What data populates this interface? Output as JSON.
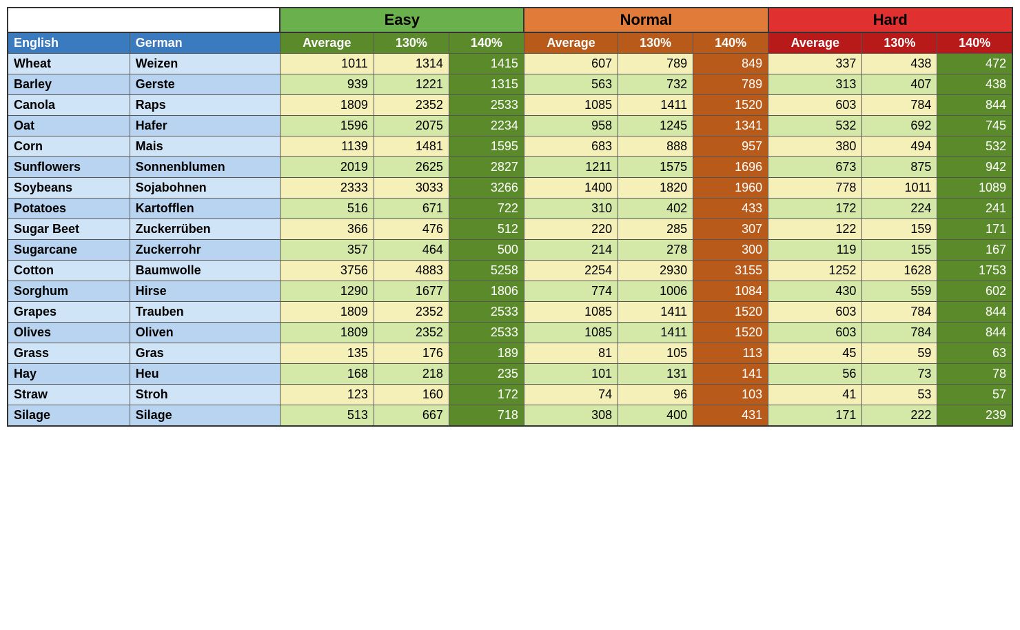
{
  "table": {
    "categories": [
      {
        "label": "Easy",
        "class": "cat-easy",
        "colspan": 3
      },
      {
        "label": "Normal",
        "class": "cat-normal",
        "colspan": 3
      },
      {
        "label": "Hard",
        "class": "cat-hard",
        "colspan": 3
      }
    ],
    "col_headers": {
      "english": "English",
      "german": "German",
      "sub_cols": [
        "Average",
        "130%",
        "140%",
        "Average",
        "130%",
        "140%",
        "Average",
        "130%",
        "140%"
      ]
    },
    "rows": [
      {
        "english": "Wheat",
        "german": "Weizen",
        "easy_avg": 1011,
        "easy_130": 1314,
        "easy_140": 1415,
        "norm_avg": 607,
        "norm_130": 789,
        "norm_140": 849,
        "hard_avg": 337,
        "hard_130": 438,
        "hard_140": 472
      },
      {
        "english": "Barley",
        "german": "Gerste",
        "easy_avg": 939,
        "easy_130": 1221,
        "easy_140": 1315,
        "norm_avg": 563,
        "norm_130": 732,
        "norm_140": 789,
        "hard_avg": 313,
        "hard_130": 407,
        "hard_140": 438
      },
      {
        "english": "Canola",
        "german": "Raps",
        "easy_avg": 1809,
        "easy_130": 2352,
        "easy_140": 2533,
        "norm_avg": 1085,
        "norm_130": 1411,
        "norm_140": 1520,
        "hard_avg": 603,
        "hard_130": 784,
        "hard_140": 844
      },
      {
        "english": "Oat",
        "german": "Hafer",
        "easy_avg": 1596,
        "easy_130": 2075,
        "easy_140": 2234,
        "norm_avg": 958,
        "norm_130": 1245,
        "norm_140": 1341,
        "hard_avg": 532,
        "hard_130": 692,
        "hard_140": 745
      },
      {
        "english": "Corn",
        "german": "Mais",
        "easy_avg": 1139,
        "easy_130": 1481,
        "easy_140": 1595,
        "norm_avg": 683,
        "norm_130": 888,
        "norm_140": 957,
        "hard_avg": 380,
        "hard_130": 494,
        "hard_140": 532
      },
      {
        "english": "Sunflowers",
        "german": "Sonnenblumen",
        "easy_avg": 2019,
        "easy_130": 2625,
        "easy_140": 2827,
        "norm_avg": 1211,
        "norm_130": 1575,
        "norm_140": 1696,
        "hard_avg": 673,
        "hard_130": 875,
        "hard_140": 942
      },
      {
        "english": "Soybeans",
        "german": "Sojabohnen",
        "easy_avg": 2333,
        "easy_130": 3033,
        "easy_140": 3266,
        "norm_avg": 1400,
        "norm_130": 1820,
        "norm_140": 1960,
        "hard_avg": 778,
        "hard_130": 1011,
        "hard_140": 1089
      },
      {
        "english": "Potatoes",
        "german": "Kartofflen",
        "easy_avg": 516,
        "easy_130": 671,
        "easy_140": 722,
        "norm_avg": 310,
        "norm_130": 402,
        "norm_140": 433,
        "hard_avg": 172,
        "hard_130": 224,
        "hard_140": 241
      },
      {
        "english": "Sugar Beet",
        "german": "Zuckerrüben",
        "easy_avg": 366,
        "easy_130": 476,
        "easy_140": 512,
        "norm_avg": 220,
        "norm_130": 285,
        "norm_140": 307,
        "hard_avg": 122,
        "hard_130": 159,
        "hard_140": 171
      },
      {
        "english": "Sugarcane",
        "german": "Zuckerrohr",
        "easy_avg": 357,
        "easy_130": 464,
        "easy_140": 500,
        "norm_avg": 214,
        "norm_130": 278,
        "norm_140": 300,
        "hard_avg": 119,
        "hard_130": 155,
        "hard_140": 167
      },
      {
        "english": "Cotton",
        "german": "Baumwolle",
        "easy_avg": 3756,
        "easy_130": 4883,
        "easy_140": 5258,
        "norm_avg": 2254,
        "norm_130": 2930,
        "norm_140": 3155,
        "hard_avg": 1252,
        "hard_130": 1628,
        "hard_140": 1753
      },
      {
        "english": "Sorghum",
        "german": "Hirse",
        "easy_avg": 1290,
        "easy_130": 1677,
        "easy_140": 1806,
        "norm_avg": 774,
        "norm_130": 1006,
        "norm_140": 1084,
        "hard_avg": 430,
        "hard_130": 559,
        "hard_140": 602
      },
      {
        "english": "Grapes",
        "german": "Trauben",
        "easy_avg": 1809,
        "easy_130": 2352,
        "easy_140": 2533,
        "norm_avg": 1085,
        "norm_130": 1411,
        "norm_140": 1520,
        "hard_avg": 603,
        "hard_130": 784,
        "hard_140": 844
      },
      {
        "english": "Olives",
        "german": "Oliven",
        "easy_avg": 1809,
        "easy_130": 2352,
        "easy_140": 2533,
        "norm_avg": 1085,
        "norm_130": 1411,
        "norm_140": 1520,
        "hard_avg": 603,
        "hard_130": 784,
        "hard_140": 844
      },
      {
        "english": "Grass",
        "german": "Gras",
        "easy_avg": 135,
        "easy_130": 176,
        "easy_140": 189,
        "norm_avg": 81,
        "norm_130": 105,
        "norm_140": 113,
        "hard_avg": 45,
        "hard_130": 59,
        "hard_140": 63
      },
      {
        "english": "Hay",
        "german": "Heu",
        "easy_avg": 168,
        "easy_130": 218,
        "easy_140": 235,
        "norm_avg": 101,
        "norm_130": 131,
        "norm_140": 141,
        "hard_avg": 56,
        "hard_130": 73,
        "hard_140": 78
      },
      {
        "english": "Straw",
        "german": "Stroh",
        "easy_avg": 123,
        "easy_130": 160,
        "easy_140": 172,
        "norm_avg": 74,
        "norm_130": 96,
        "norm_140": 103,
        "hard_avg": 41,
        "hard_130": 53,
        "hard_140": 57
      },
      {
        "english": "Silage",
        "german": "Silage",
        "easy_avg": 513,
        "easy_130": 667,
        "easy_140": 718,
        "norm_avg": 308,
        "norm_130": 400,
        "norm_140": 431,
        "hard_avg": 171,
        "hard_130": 222,
        "hard_140": 239
      }
    ],
    "colors": {
      "easy_bg": "#6ab04c",
      "normal_bg": "#e07b39",
      "hard_bg": "#e03030",
      "header_blue": "#3a7abf",
      "row_light": "#d0e4f8",
      "row_dark": "#b8d4f0",
      "cell_odd_easy": "#f5f0b8",
      "cell_even_easy": "#d4e8a8",
      "cell_odd_normal": "#f5f0b8",
      "cell_even_normal": "#d4e8a8",
      "cell_odd_hard": "#f5f0b8",
      "cell_even_hard": "#d4e8a8"
    }
  }
}
